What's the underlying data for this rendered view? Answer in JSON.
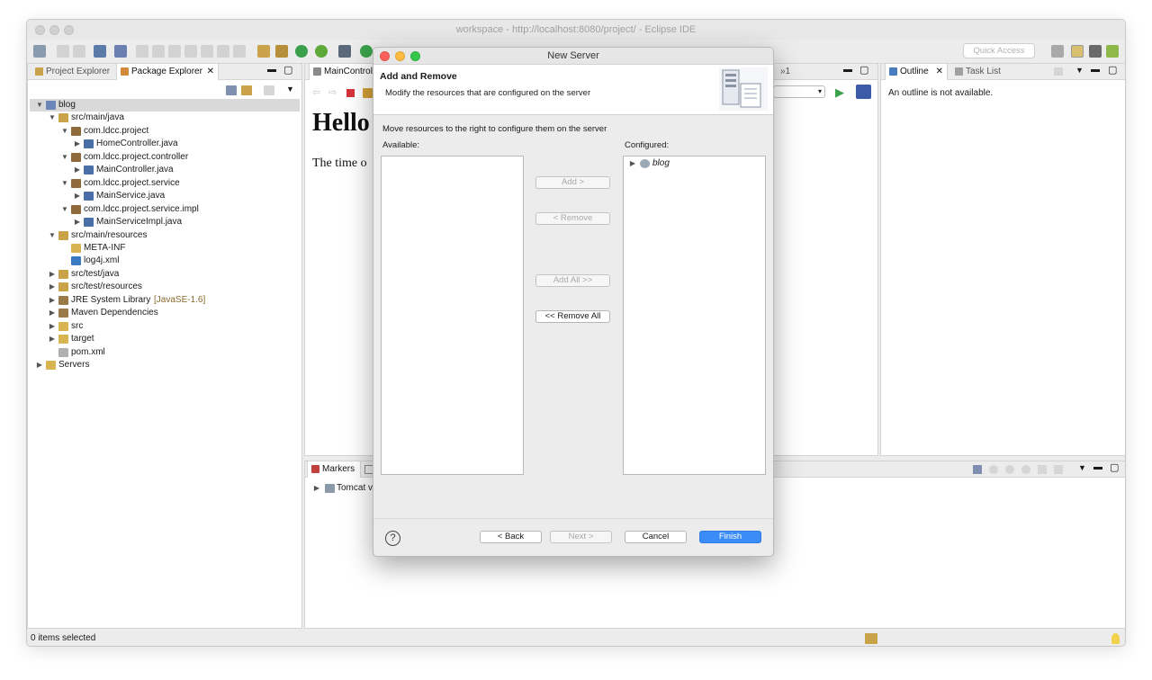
{
  "window": {
    "title": "workspace - http://localhost:8080/project/ - Eclipse IDE"
  },
  "toolbar": {
    "quick_access_placeholder": "Quick Access"
  },
  "left_panel": {
    "tabs": [
      {
        "label": "Project Explorer",
        "active": false
      },
      {
        "label": "Package Explorer",
        "active": true
      }
    ],
    "tree": [
      {
        "label": "blog",
        "depth": 0,
        "expanded": true,
        "icon": "project-icon",
        "selected": true
      },
      {
        "label": "src/main/java",
        "depth": 1,
        "expanded": true,
        "icon": "source-folder-icon"
      },
      {
        "label": "com.ldcc.project",
        "depth": 2,
        "expanded": true,
        "icon": "package-icon"
      },
      {
        "label": "HomeController.java",
        "depth": 3,
        "expanded": false,
        "icon": "java-file-icon"
      },
      {
        "label": "com.ldcc.project.controller",
        "depth": 2,
        "expanded": true,
        "icon": "package-icon"
      },
      {
        "label": "MainController.java",
        "depth": 3,
        "expanded": false,
        "icon": "java-file-icon"
      },
      {
        "label": "com.ldcc.project.service",
        "depth": 2,
        "expanded": true,
        "icon": "package-icon"
      },
      {
        "label": "MainService.java",
        "depth": 3,
        "expanded": false,
        "icon": "java-file-icon"
      },
      {
        "label": "com.ldcc.project.service.impl",
        "depth": 2,
        "expanded": true,
        "icon": "package-icon"
      },
      {
        "label": "MainServiceImpl.java",
        "depth": 3,
        "expanded": false,
        "icon": "java-file-icon"
      },
      {
        "label": "src/main/resources",
        "depth": 1,
        "expanded": true,
        "icon": "source-folder-icon"
      },
      {
        "label": "META-INF",
        "depth": 2,
        "expanded": null,
        "icon": "folder-icon"
      },
      {
        "label": "log4j.xml",
        "depth": 2,
        "expanded": null,
        "icon": "xml-file-icon"
      },
      {
        "label": "src/test/java",
        "depth": 1,
        "expanded": false,
        "icon": "source-folder-icon"
      },
      {
        "label": "src/test/resources",
        "depth": 1,
        "expanded": false,
        "icon": "source-folder-icon"
      },
      {
        "label": "JRE System Library",
        "suffix": "[JavaSE-1.6]",
        "depth": 1,
        "expanded": false,
        "icon": "library-icon"
      },
      {
        "label": "Maven Dependencies",
        "depth": 1,
        "expanded": false,
        "icon": "library-icon"
      },
      {
        "label": "src",
        "depth": 1,
        "expanded": false,
        "icon": "folder-icon"
      },
      {
        "label": "target",
        "depth": 1,
        "expanded": false,
        "icon": "folder-icon"
      },
      {
        "label": "pom.xml",
        "depth": 1,
        "expanded": null,
        "icon": "maven-file-icon"
      },
      {
        "label": "Servers",
        "depth": 0,
        "expanded": false,
        "icon": "folder-icon"
      }
    ]
  },
  "editor": {
    "tab_label": "MainControll",
    "overflow_label": "»1",
    "heading": "Hello",
    "body_text": "The time o"
  },
  "outline": {
    "tabs": [
      {
        "label": "Outline",
        "active": true
      },
      {
        "label": "Task List",
        "active": false
      }
    ],
    "message": "An outline is not available."
  },
  "bottom": {
    "tab_label": "Markers",
    "row_label": "Tomcat v"
  },
  "status": {
    "text": "0 items selected"
  },
  "dialog": {
    "title": "New Server",
    "header_title": "Add and Remove",
    "header_desc": "Modify the resources that are configured on the server",
    "instruction": "Move resources to the right to configure them on the server",
    "available_label": "Available:",
    "configured_label": "Configured:",
    "configured_items": [
      "blog"
    ],
    "buttons": {
      "add": "Add >",
      "remove": "< Remove",
      "add_all": "Add All >>",
      "remove_all": "<< Remove All",
      "back": "< Back",
      "next": "Next >",
      "cancel": "Cancel",
      "finish": "Finish"
    },
    "help_glyph": "?"
  },
  "colors": {
    "primary_button": "#3b8cf6",
    "close_red": "#fc605c",
    "minimize_yellow": "#fdbc40",
    "zoom_green": "#34c84a"
  }
}
